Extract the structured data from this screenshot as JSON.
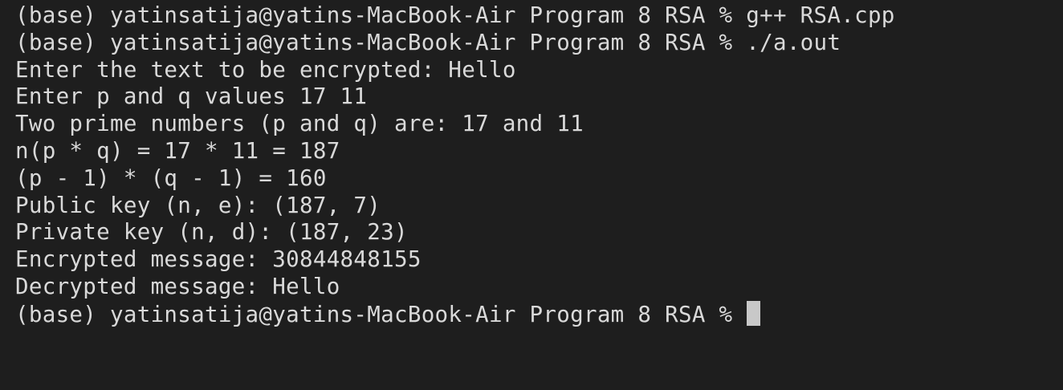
{
  "terminal": {
    "lines": [
      "(base) yatinsatija@yatins-MacBook-Air Program 8 RSA % g++ RSA.cpp",
      "(base) yatinsatija@yatins-MacBook-Air Program 8 RSA % ./a.out",
      "Enter the text to be encrypted: Hello",
      "Enter p and q values 17 11",
      "Two prime numbers (p and q) are: 17 and 11",
      "n(p * q) = 17 * 11 = 187",
      "(p - 1) * (q - 1) = 160",
      "Public key (n, e): (187, 7)",
      "Private key (n, d): (187, 23)",
      "Encrypted message: 30844848155",
      "Decrypted message: Hello"
    ],
    "prompt": "(base) yatinsatija@yatins-MacBook-Air Program 8 RSA % "
  },
  "colors": {
    "background": "#1e1e1e",
    "text": "#d9d9d9",
    "cursor": "#c8c8c8"
  }
}
